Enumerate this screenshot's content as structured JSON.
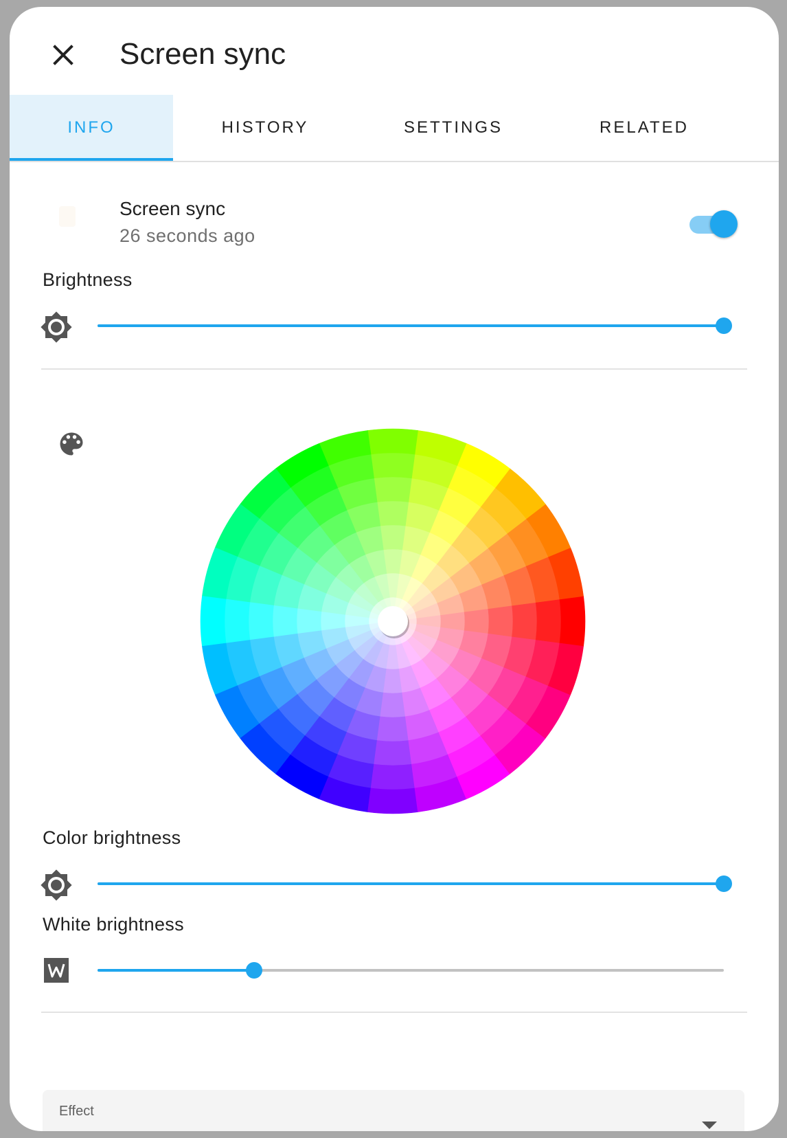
{
  "dialog": {
    "title": "Screen sync",
    "close_icon": "close-icon"
  },
  "tabs": [
    {
      "label": "INFO",
      "active": true
    },
    {
      "label": "HISTORY",
      "active": false
    },
    {
      "label": "SETTINGS",
      "active": false
    },
    {
      "label": "RELATED",
      "active": false
    }
  ],
  "entity": {
    "name": "Screen sync",
    "last_changed": "26 seconds ago",
    "state_on": true
  },
  "brightness": {
    "label": "Brightness",
    "icon": "brightness-icon",
    "value_pct": 100
  },
  "color": {
    "icon": "palette-icon",
    "wheel_selected": "white"
  },
  "color_brightness": {
    "label": "Color brightness",
    "icon": "brightness-icon",
    "value_pct": 100
  },
  "white_brightness": {
    "label": "White brightness",
    "icon": "white-w-icon",
    "value_pct": 25
  },
  "effect": {
    "label": "Effect"
  },
  "colors": {
    "accent": "#1fa6ee",
    "accent_light": "#86cdf5",
    "tab_active_bg": "#e3f2fb"
  }
}
